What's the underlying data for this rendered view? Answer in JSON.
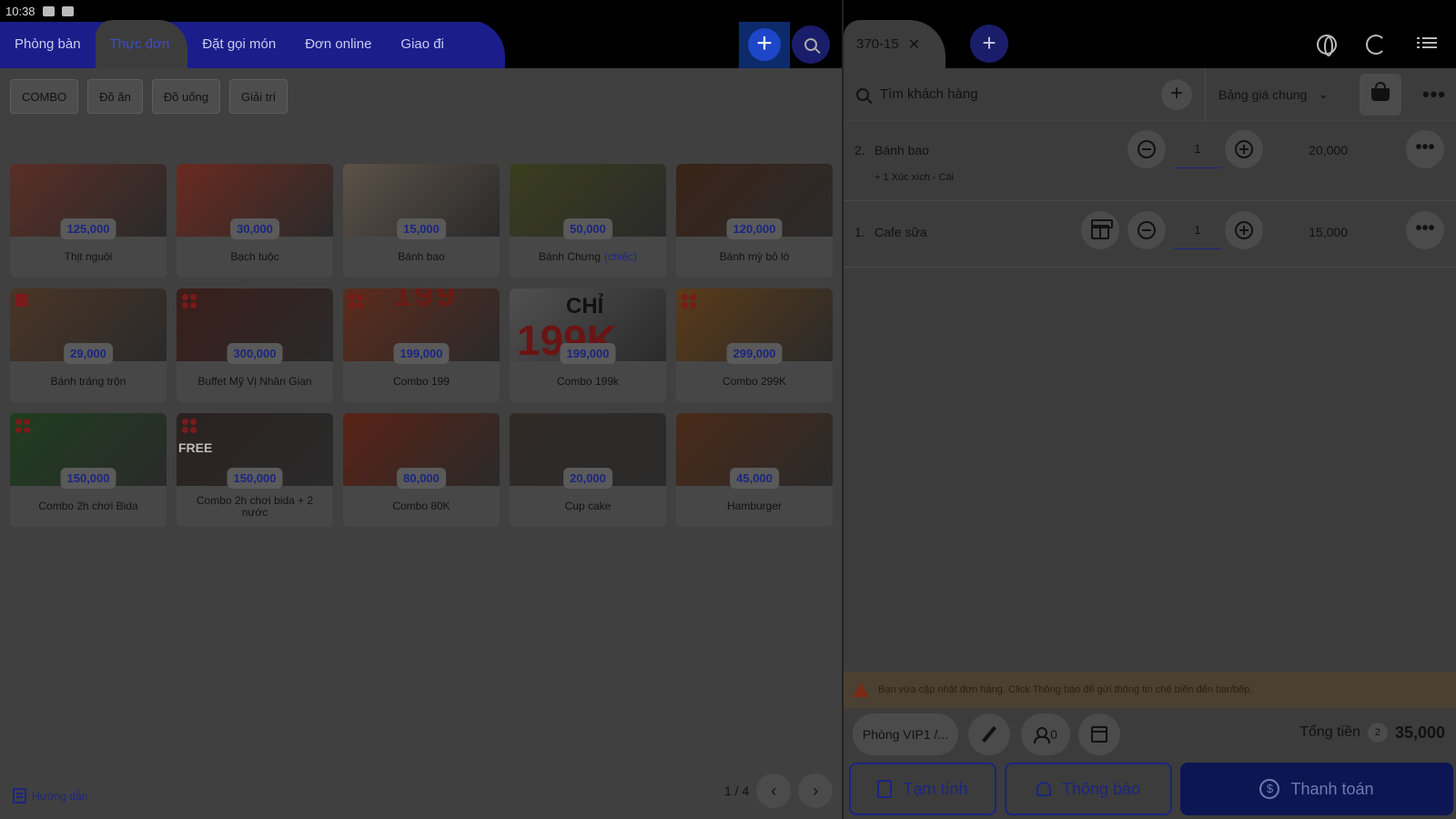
{
  "status_bar": {
    "time": "10:38"
  },
  "nav": {
    "tabs": [
      {
        "label": "Phòng bàn"
      },
      {
        "label": "Thực đơn"
      },
      {
        "label": "Đặt gọi món"
      },
      {
        "label": "Đơn online"
      },
      {
        "label": "Giao đi"
      }
    ],
    "active_tab": "Thực đơn"
  },
  "categories": [
    "COMBO",
    "Đồ ăn",
    "Đồ uống",
    "Giải trí"
  ],
  "menu_items": [
    {
      "name": "Thịt nguội",
      "price": "125,000",
      "color": "#5a2e26"
    },
    {
      "name": "Bạch tuộc",
      "price": "30,000",
      "color": "#6a2a20"
    },
    {
      "name": "Bánh bao",
      "price": "15,000",
      "color": "#5c5248"
    },
    {
      "name": "Bánh Chưng",
      "name_accent": "(chiếc)",
      "price": "50,000",
      "color": "#3a3e1e"
    },
    {
      "name": "Bánh mỳ bỏ lò",
      "price": "120,000",
      "color": "#3a2418"
    },
    {
      "name": "Bánh tráng trộn",
      "price": "29,000",
      "color": "#4a3526"
    },
    {
      "name": "Buffet Mỹ Vị Nhân Gian",
      "price": "300,000",
      "color": "#3a1e1a"
    },
    {
      "name": "Combo 199",
      "price": "199,000",
      "color": "#5c2b1c"
    },
    {
      "name": "Combo 199k",
      "price": "199,000",
      "color": "#505050"
    },
    {
      "name": "Combo 299K",
      "price": "299,000",
      "color": "#5a3a18"
    },
    {
      "name": "Combo 2h chơi Bida",
      "price": "150,000",
      "color": "#1f3d1f"
    },
    {
      "name": "Combo 2h chơi bida + 2 nước",
      "price": "150,000",
      "color": "#2a2220"
    },
    {
      "name": "Combo 80K",
      "price": "80,000",
      "color": "#5a2216"
    },
    {
      "name": "Cup cake",
      "price": "20,000",
      "color": "#302a26"
    },
    {
      "name": "Hamburger",
      "price": "45,000",
      "color": "#4a2a18"
    }
  ],
  "menu_text": {
    "chi": "CHỈ",
    "k199": "199K",
    "n199": "199",
    "free": "FREE"
  },
  "guide_label": "Hướng dẫn",
  "pager": {
    "text": "1 / 4"
  },
  "order": {
    "tab_label": "370-15",
    "customer_placeholder": "Tìm khách hàng",
    "price_list": "Bảng giá chung",
    "lines": [
      {
        "idx": "2.",
        "name": "Bánh bao",
        "sub": "+ 1 Xúc xích - Cái",
        "qty": "1",
        "price": "20,000"
      },
      {
        "idx": "1.",
        "name": "Cafe sữa",
        "qty": "1",
        "price": "15,000"
      }
    ],
    "notice": "Bạn vừa cập nhật đơn hàng. Click Thông báo để gửi thông tin chế biến đến bar/bếp.",
    "room": "Phòng VIP1 /...",
    "guests": "0",
    "total_label": "Tổng tiền",
    "total_count": "2",
    "total_amount": "35,000",
    "btn_estimate": "Tạm tính",
    "btn_notify": "Thông báo",
    "btn_pay": "Thanh toán"
  }
}
